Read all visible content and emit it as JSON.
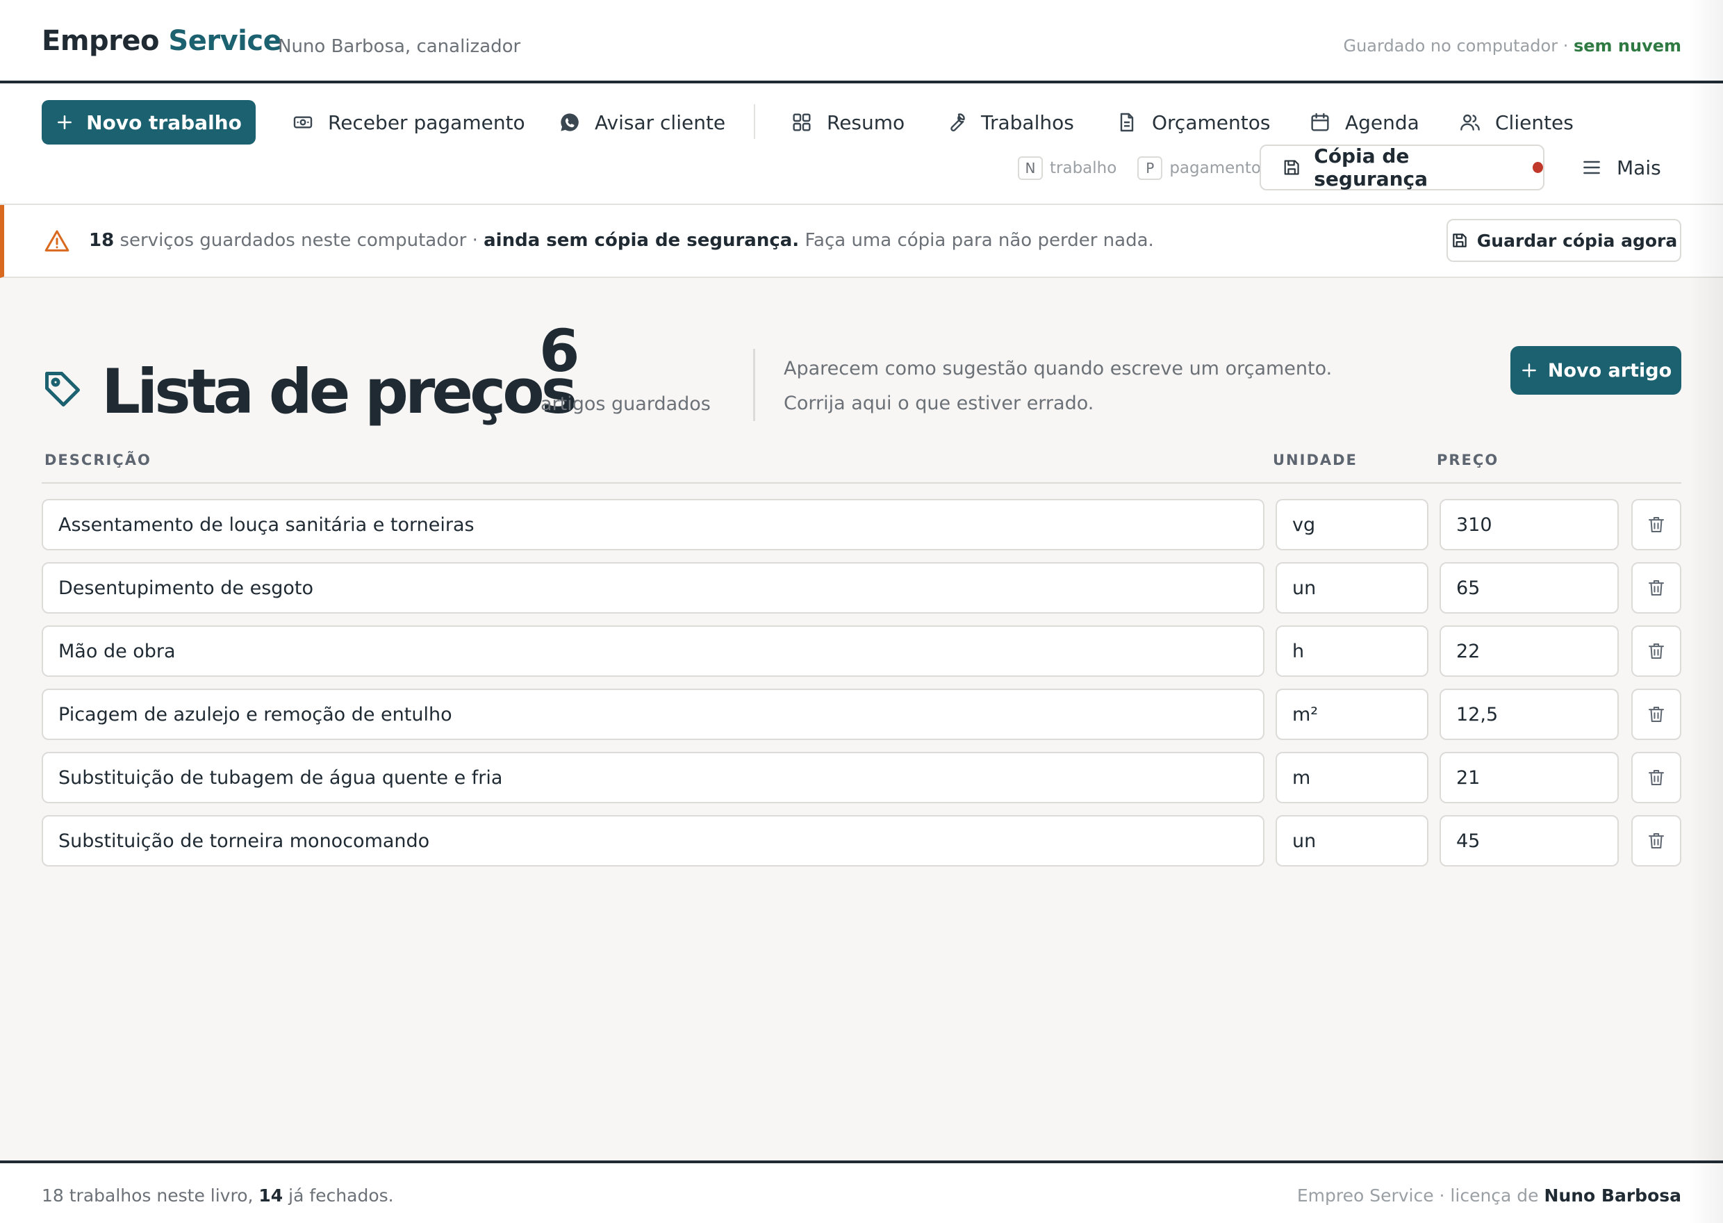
{
  "app": {
    "brand_primary": "Empreo",
    "brand_accent": "Service",
    "owner": "Nuno Barbosa, canalizador",
    "storage_status": "Guardado no computador ·",
    "storage_cloud": "sem nuvem"
  },
  "toolbar": {
    "new_job": "Novo trabalho",
    "receive_payment": "Receber pagamento",
    "notify_client": "Avisar cliente",
    "nav": {
      "summary": "Resumo",
      "jobs": "Trabalhos",
      "quotes": "Orçamentos",
      "agenda": "Agenda",
      "clients": "Clientes"
    },
    "shortcuts": [
      {
        "key": "N",
        "label": "trabalho"
      },
      {
        "key": "P",
        "label": "pagamento"
      }
    ],
    "backup": "Cópia de segurança",
    "more": "Mais"
  },
  "alert": {
    "count": "18",
    "text1": "serviços guardados neste computador ·",
    "bold": "ainda sem cópia de segurança.",
    "text2": "Faça uma cópia para não perder nada.",
    "button": "Guardar cópia agora"
  },
  "page": {
    "title": "Lista de preços",
    "count": "6",
    "count_label": "artigos guardados",
    "hint_line1": "Aparecem como sugestão quando escreve um orçamento.",
    "hint_line2": "Corrija aqui o que estiver errado.",
    "new_item": "Novo artigo"
  },
  "table": {
    "headers": {
      "description": "DESCRIÇÃO",
      "unit": "UNIDADE",
      "price": "PREÇO"
    },
    "rows": [
      {
        "description": "Assentamento de louça sanitária e torneiras",
        "unit": "vg",
        "price": "310"
      },
      {
        "description": "Desentupimento de esgoto",
        "unit": "un",
        "price": "65"
      },
      {
        "description": "Mão de obra",
        "unit": "h",
        "price": "22"
      },
      {
        "description": "Picagem de azulejo e remoção de entulho",
        "unit": "m²",
        "price": "12,5"
      },
      {
        "description": "Substituição de tubagem de água quente e fria",
        "unit": "m",
        "price": "21"
      },
      {
        "description": "Substituição de torneira monocomando",
        "unit": "un",
        "price": "45"
      }
    ]
  },
  "footer": {
    "left_pre": "18 trabalhos neste livro,",
    "left_num": "14",
    "left_post": "já fechados.",
    "right_pre": "Empreo Service · licença de",
    "right_name": "Nuno Barbosa"
  },
  "colors": {
    "accent": "#1c6170",
    "warning": "#d9691f",
    "status_dot": "#c0392b",
    "cloud_status": "#2f7a43"
  },
  "icons": [
    "plus-icon",
    "cash-icon",
    "whatsapp-icon",
    "grid-icon",
    "wrench-icon",
    "document-icon",
    "calendar-icon",
    "users-icon",
    "save-icon",
    "menu-icon",
    "warning-icon",
    "tag-icon",
    "trash-icon"
  ]
}
